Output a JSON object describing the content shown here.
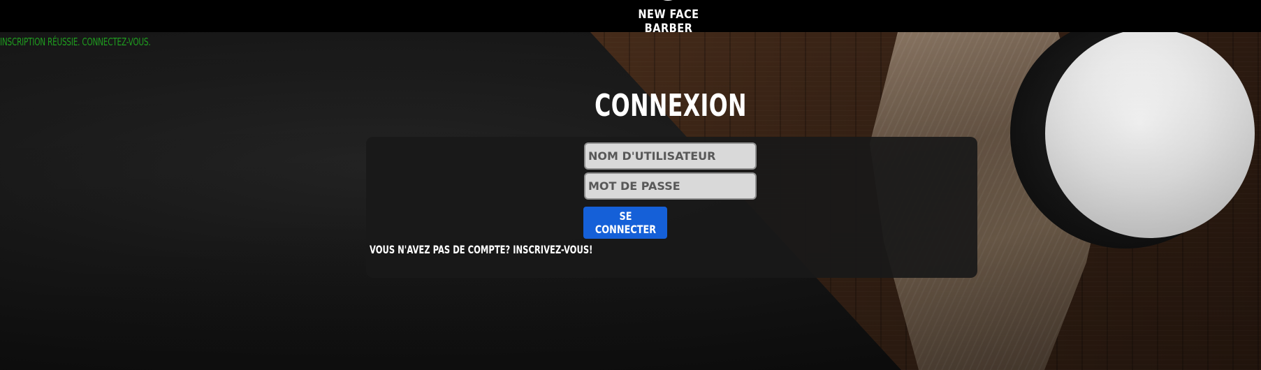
{
  "header": {
    "logo_text": "NEW FACE BARBER"
  },
  "flash_message": "INSCRIPTION RÉUSSIE. CONNECTEZ-VOUS.",
  "login": {
    "title": "CONNEXION",
    "username_placeholder": "NOM D'UTILISATEUR",
    "password_placeholder": "MOT DE PASSE",
    "submit_label": "SE CONNECTER",
    "signup_link": "VOUS N'AVEZ PAS DE COMPTE? INSCRIVEZ-VOUS!"
  },
  "colors": {
    "success": "#1f9d1f",
    "button": "#1560d8",
    "header_bg": "#000000"
  }
}
